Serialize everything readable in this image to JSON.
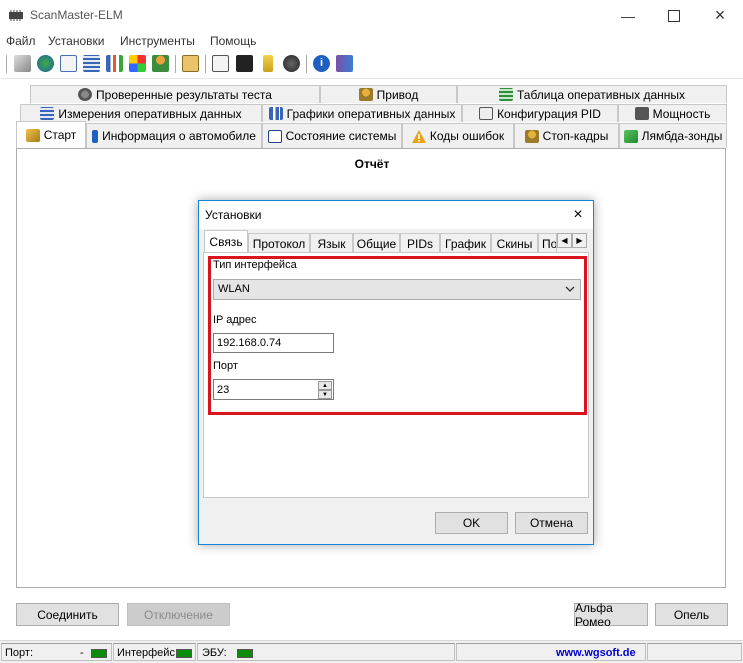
{
  "window": {
    "title": "ScanMaster-ELM"
  },
  "menu": [
    "Файл",
    "Установки",
    "Инструменты",
    "Помощь"
  ],
  "tabs": {
    "row1": [
      "Проверенные результаты теста",
      "Привод",
      "Таблица оперативных данных"
    ],
    "row2": [
      "Измерения оперативных данных",
      "Графики оперативных данных",
      "Конфигурация PID",
      "Мощность"
    ],
    "row3": [
      "Старт",
      "Информация о автомобиле",
      "Состояние системы",
      "Коды ошибок",
      "Стоп-кадры",
      "Лямбда-зонды"
    ]
  },
  "main": {
    "report_title": "Отчёт"
  },
  "buttons": {
    "connect": "Соединить",
    "disconnect": "Отключение",
    "alfa": "Альфа Ромео",
    "opel": "Опель"
  },
  "status": {
    "port_label": "Порт:",
    "port_value": "-",
    "interface_label": "Интерфейс:",
    "ecu_label": "ЭБУ:",
    "site": "www.wgsoft.de"
  },
  "dialog": {
    "title": "Установки",
    "tabs": [
      "Связь",
      "Протокол",
      "Язык",
      "Общие",
      "PIDs",
      "График",
      "Скины",
      "По"
    ],
    "interface_type_label": "Тип интерфейса",
    "interface_type_value": "WLAN",
    "ip_label": "IP адрес",
    "ip_value": "192.168.0.74",
    "port_label": "Порт",
    "port_value": "23",
    "ok": "OK",
    "cancel": "Отмена"
  },
  "colors": {
    "highlight": "#d9141e",
    "status_led": "#0b8a0b",
    "link": "#0000cc",
    "dialog_border": "#1883d7"
  }
}
